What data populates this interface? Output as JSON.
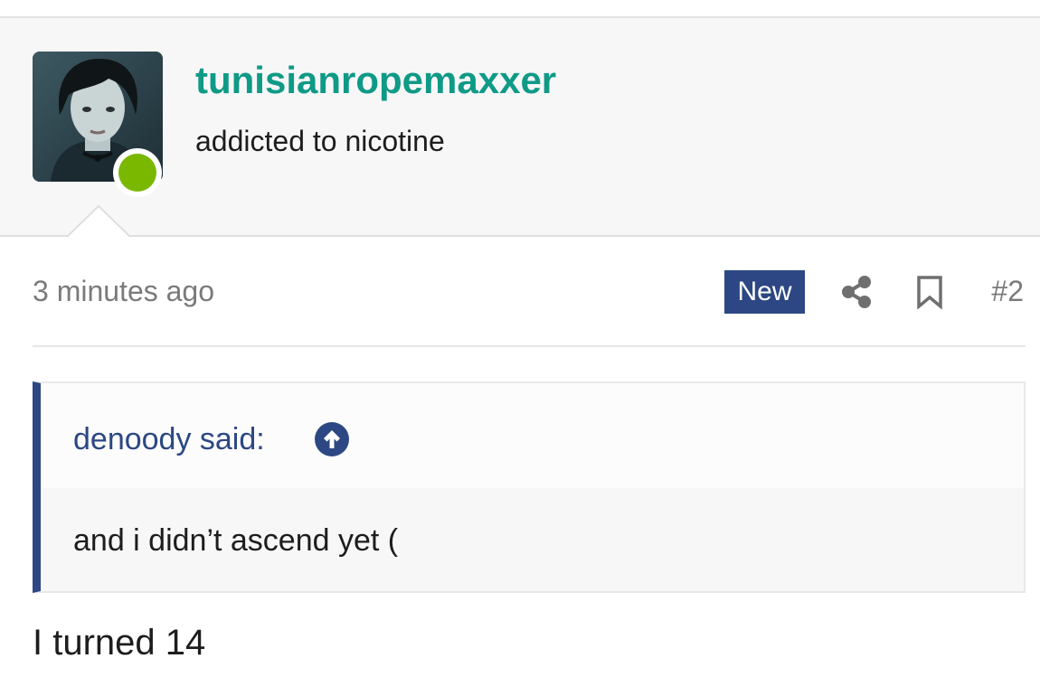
{
  "user": {
    "name": "tunisianropemaxxer",
    "title": "addicted to nicotine",
    "status": "online",
    "avatar_icon": "avatar-photo",
    "status_color": "#7ab800",
    "name_color": "#0e9a87"
  },
  "post": {
    "time": "3 minutes ago",
    "badge": "New",
    "badge_color": "#2c4783",
    "number": "#2",
    "actions": [
      "share-icon",
      "bookmark-icon"
    ],
    "quote": {
      "author_line": "denoody said:",
      "jump_icon": "arrow-up-circle-icon",
      "text": "and i didn’t ascend yet ("
    },
    "body": "I turned 14"
  }
}
